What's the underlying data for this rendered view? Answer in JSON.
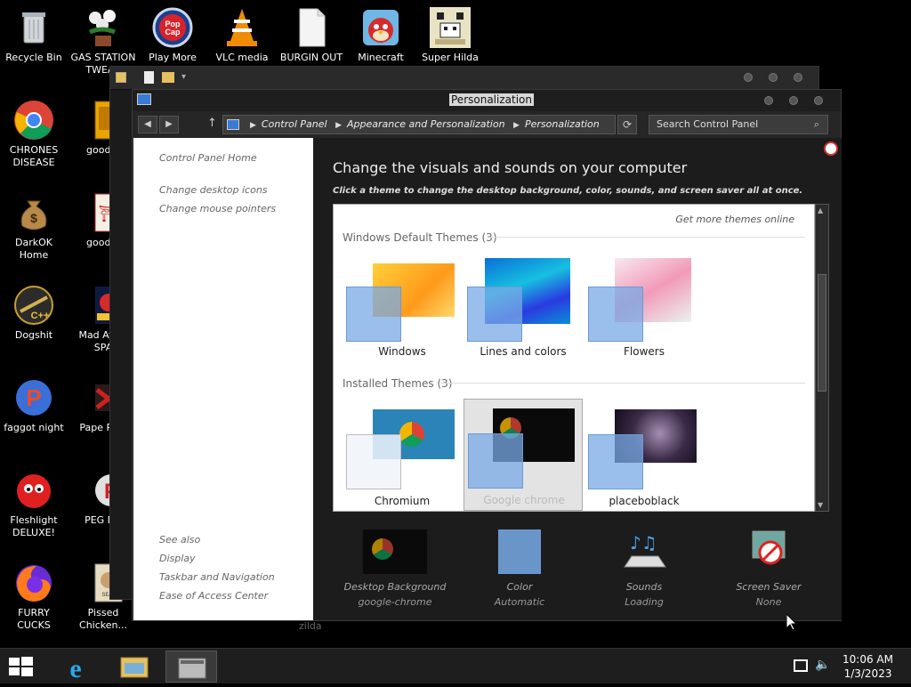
{
  "desktop": {
    "icons": [
      {
        "label": "Recycle Bin"
      },
      {
        "label": "GAS STATION TWEAK"
      },
      {
        "label": "Play More"
      },
      {
        "label": "VLC media"
      },
      {
        "label": "BURGIN OUT"
      },
      {
        "label": "Minecraft"
      },
      {
        "label": "Super Hilda"
      },
      {
        "label": "CHRONES DISEASE"
      },
      {
        "label": "good g"
      },
      {
        "label": "DarkOK Home"
      },
      {
        "label": "good g"
      },
      {
        "label": "Dogshit"
      },
      {
        "label": "Mad Av IN SPA"
      },
      {
        "label": "faggot night"
      },
      {
        "label": "Pape Plea"
      },
      {
        "label": "Fleshlight DELUXE!"
      },
      {
        "label": "PEG MY"
      },
      {
        "label": "FURRY CUCKS"
      },
      {
        "label": "Pissed Chicken..."
      }
    ],
    "partial_text": "zilda"
  },
  "window": {
    "title": "Personalization",
    "breadcrumb": [
      "Control Panel",
      "Appearance and Personalization",
      "Personalization"
    ],
    "search_placeholder": "Search Control Panel",
    "left_nav": {
      "home": "Control Panel Home",
      "links": [
        "Change desktop icons",
        "Change mouse pointers"
      ],
      "see_also_title": "See also",
      "see_also": [
        "Display",
        "Taskbar and Navigation",
        "Ease of Access Center"
      ]
    },
    "heading": "Change the visuals and sounds on your computer",
    "subheading": "Click a theme to change the desktop background, color, sounds, and screen saver all at once.",
    "get_more": "Get more themes online",
    "groups": [
      {
        "title": "Windows Default Themes (3)",
        "themes": [
          "Windows",
          "Lines and colors",
          "Flowers"
        ]
      },
      {
        "title": "Installed Themes (3)",
        "themes": [
          "Chromium",
          "Google chrome",
          "placeboblack"
        ]
      }
    ],
    "selected_theme": "Google chrome",
    "bottom": [
      {
        "label": "Desktop Background",
        "value": "google-chrome"
      },
      {
        "label": "Color",
        "value": "Automatic"
      },
      {
        "label": "Sounds",
        "value": "Loading"
      },
      {
        "label": "Screen Saver",
        "value": "None"
      }
    ]
  },
  "taskbar": {
    "time": "10:06 AM",
    "date": "1/3/2023"
  }
}
